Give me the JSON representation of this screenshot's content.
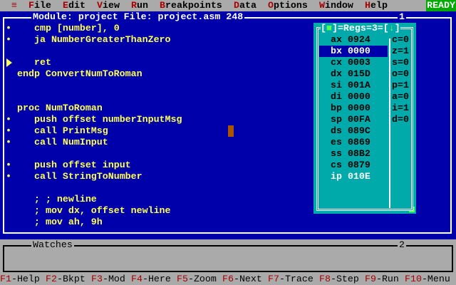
{
  "menu": {
    "system": "≡",
    "items": [
      {
        "hot": "F",
        "rest": "ile"
      },
      {
        "hot": "E",
        "rest": "dit"
      },
      {
        "hot": "V",
        "rest": "iew"
      },
      {
        "hot": "R",
        "rest": "un"
      },
      {
        "hot": "B",
        "rest": "reakpoints"
      },
      {
        "hot": "D",
        "rest": "ata"
      },
      {
        "hot": "O",
        "rest": "ptions"
      },
      {
        "hot": "W",
        "rest": "indow"
      },
      {
        "hot": "H",
        "rest": "elp"
      }
    ],
    "status": "READY"
  },
  "module": {
    "title": "Module: project File: project.asm 248",
    "number": "1",
    "lines": [
      {
        "text": "cmp [number], 0",
        "bp": true
      },
      {
        "text": "ja NumberGreaterThanZero",
        "bp": true
      },
      {
        "text": "",
        "bp": false
      },
      {
        "text": "ret",
        "bp": false,
        "current": true
      },
      {
        "text": "endp ConvertNumToRoman",
        "bp": false
      },
      {
        "text": "",
        "bp": false
      },
      {
        "text": "",
        "bp": false
      },
      {
        "text": "proc NumToRoman",
        "bp": false
      },
      {
        "text": "push offset numberInputMsg",
        "bp": true
      },
      {
        "text": "call PrintMsg",
        "bp": true
      },
      {
        "text": "call NumInput",
        "bp": true
      },
      {
        "text": "",
        "bp": false
      },
      {
        "text": "push offset input",
        "bp": true
      },
      {
        "text": "call StringToNumber",
        "bp": true
      },
      {
        "text": "",
        "bp": false
      },
      {
        "text": "; ; newline",
        "bp": false
      },
      {
        "text": "; mov dx, offset newline",
        "bp": false
      },
      {
        "text": "; mov ah, 9h",
        "bp": false
      }
    ]
  },
  "regs": {
    "title_pre": "[",
    "title_close": "■",
    "title_mid": "]=Regs=3=[",
    "title_arrow": "↓",
    "title_end": "]",
    "registers": [
      {
        "name": "ax",
        "value": "0924"
      },
      {
        "name": "bx",
        "value": "0000"
      },
      {
        "name": "cx",
        "value": "0003"
      },
      {
        "name": "dx",
        "value": "015D"
      },
      {
        "name": "si",
        "value": "001A"
      },
      {
        "name": "di",
        "value": "0000"
      },
      {
        "name": "bp",
        "value": "0000"
      },
      {
        "name": "sp",
        "value": "00FA"
      },
      {
        "name": "ds",
        "value": "089C"
      },
      {
        "name": "es",
        "value": "0869"
      },
      {
        "name": "ss",
        "value": "08B2"
      },
      {
        "name": "cs",
        "value": "0879"
      },
      {
        "name": "ip",
        "value": "010E"
      }
    ],
    "flags": [
      "c=0",
      "z=1",
      "s=0",
      "o=0",
      "p=1",
      "a=0",
      "i=1",
      "d=0"
    ]
  },
  "watches": {
    "title": "Watches",
    "number": "2"
  },
  "fkeys": [
    {
      "key": "F1",
      "label": "-Help"
    },
    {
      "key": "F2",
      "label": "-Bkpt"
    },
    {
      "key": "F3",
      "label": "-Mod"
    },
    {
      "key": "F4",
      "label": "-Here"
    },
    {
      "key": "F5",
      "label": "-Zoom"
    },
    {
      "key": "F6",
      "label": "-Next"
    },
    {
      "key": "F7",
      "label": "-Trace"
    },
    {
      "key": "F8",
      "label": "-Step"
    },
    {
      "key": "F9",
      "label": "-Run"
    },
    {
      "key": "F10",
      "label": "-Menu"
    }
  ]
}
